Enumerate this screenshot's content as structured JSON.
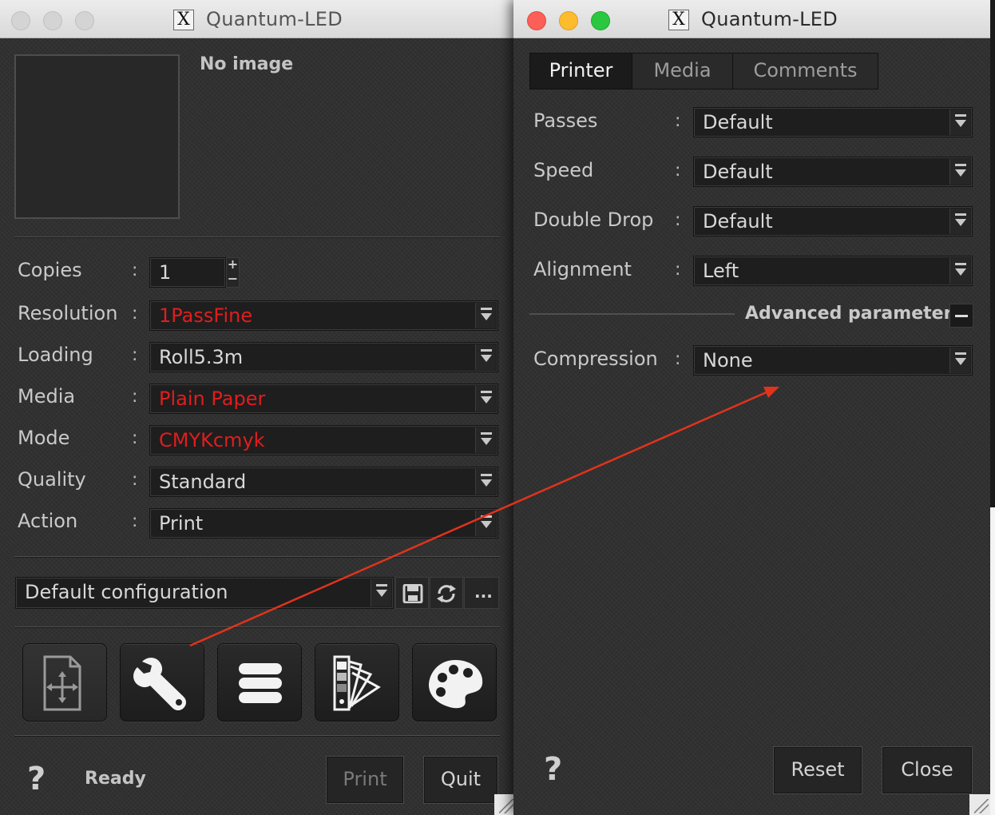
{
  "colors": {
    "accent_red": "#e11d1d",
    "annotation_arrow": "#e0331c",
    "panel_bg": "#2f2f2f"
  },
  "left_window": {
    "title": "Quantum-LED",
    "preview": {
      "placeholder": "No image"
    },
    "fields": {
      "copies": {
        "label": "Copies",
        "value": "1"
      },
      "resolution": {
        "label": "Resolution",
        "value": "1PassFine"
      },
      "loading": {
        "label": "Loading",
        "value": "Roll5.3m"
      },
      "media": {
        "label": "Media",
        "value": "Plain Paper"
      },
      "mode": {
        "label": "Mode",
        "value": "CMYKcmyk"
      },
      "quality": {
        "label": "Quality",
        "value": "Standard"
      },
      "action": {
        "label": "Action",
        "value": "Print"
      }
    },
    "colon": ":",
    "configuration": {
      "value": "Default configuration",
      "more_label": "..."
    },
    "toolbar_icons": [
      "layout-move-icon",
      "wrench-icon",
      "stack-icon",
      "color-swatch-icon",
      "palette-icon"
    ],
    "help_symbol": "?",
    "status": "Ready",
    "buttons": {
      "print": "Print",
      "quit": "Quit"
    }
  },
  "right_window": {
    "title": "Quantum-LED",
    "tabs": [
      "Printer",
      "Media",
      "Comments"
    ],
    "active_tab": "Printer",
    "fields": {
      "passes": {
        "label": "Passes",
        "value": "Default"
      },
      "speed": {
        "label": "Speed",
        "value": "Default"
      },
      "double_drop": {
        "label": "Double Drop",
        "value": "Default"
      },
      "alignment": {
        "label": "Alignment",
        "value": "Left"
      },
      "compression": {
        "label": "Compression",
        "value": "None"
      }
    },
    "colon": ":",
    "advanced_section": {
      "label": "Advanced parameters",
      "expanded": true
    },
    "help_symbol": "?",
    "buttons": {
      "reset": "Reset",
      "close": "Close"
    }
  }
}
